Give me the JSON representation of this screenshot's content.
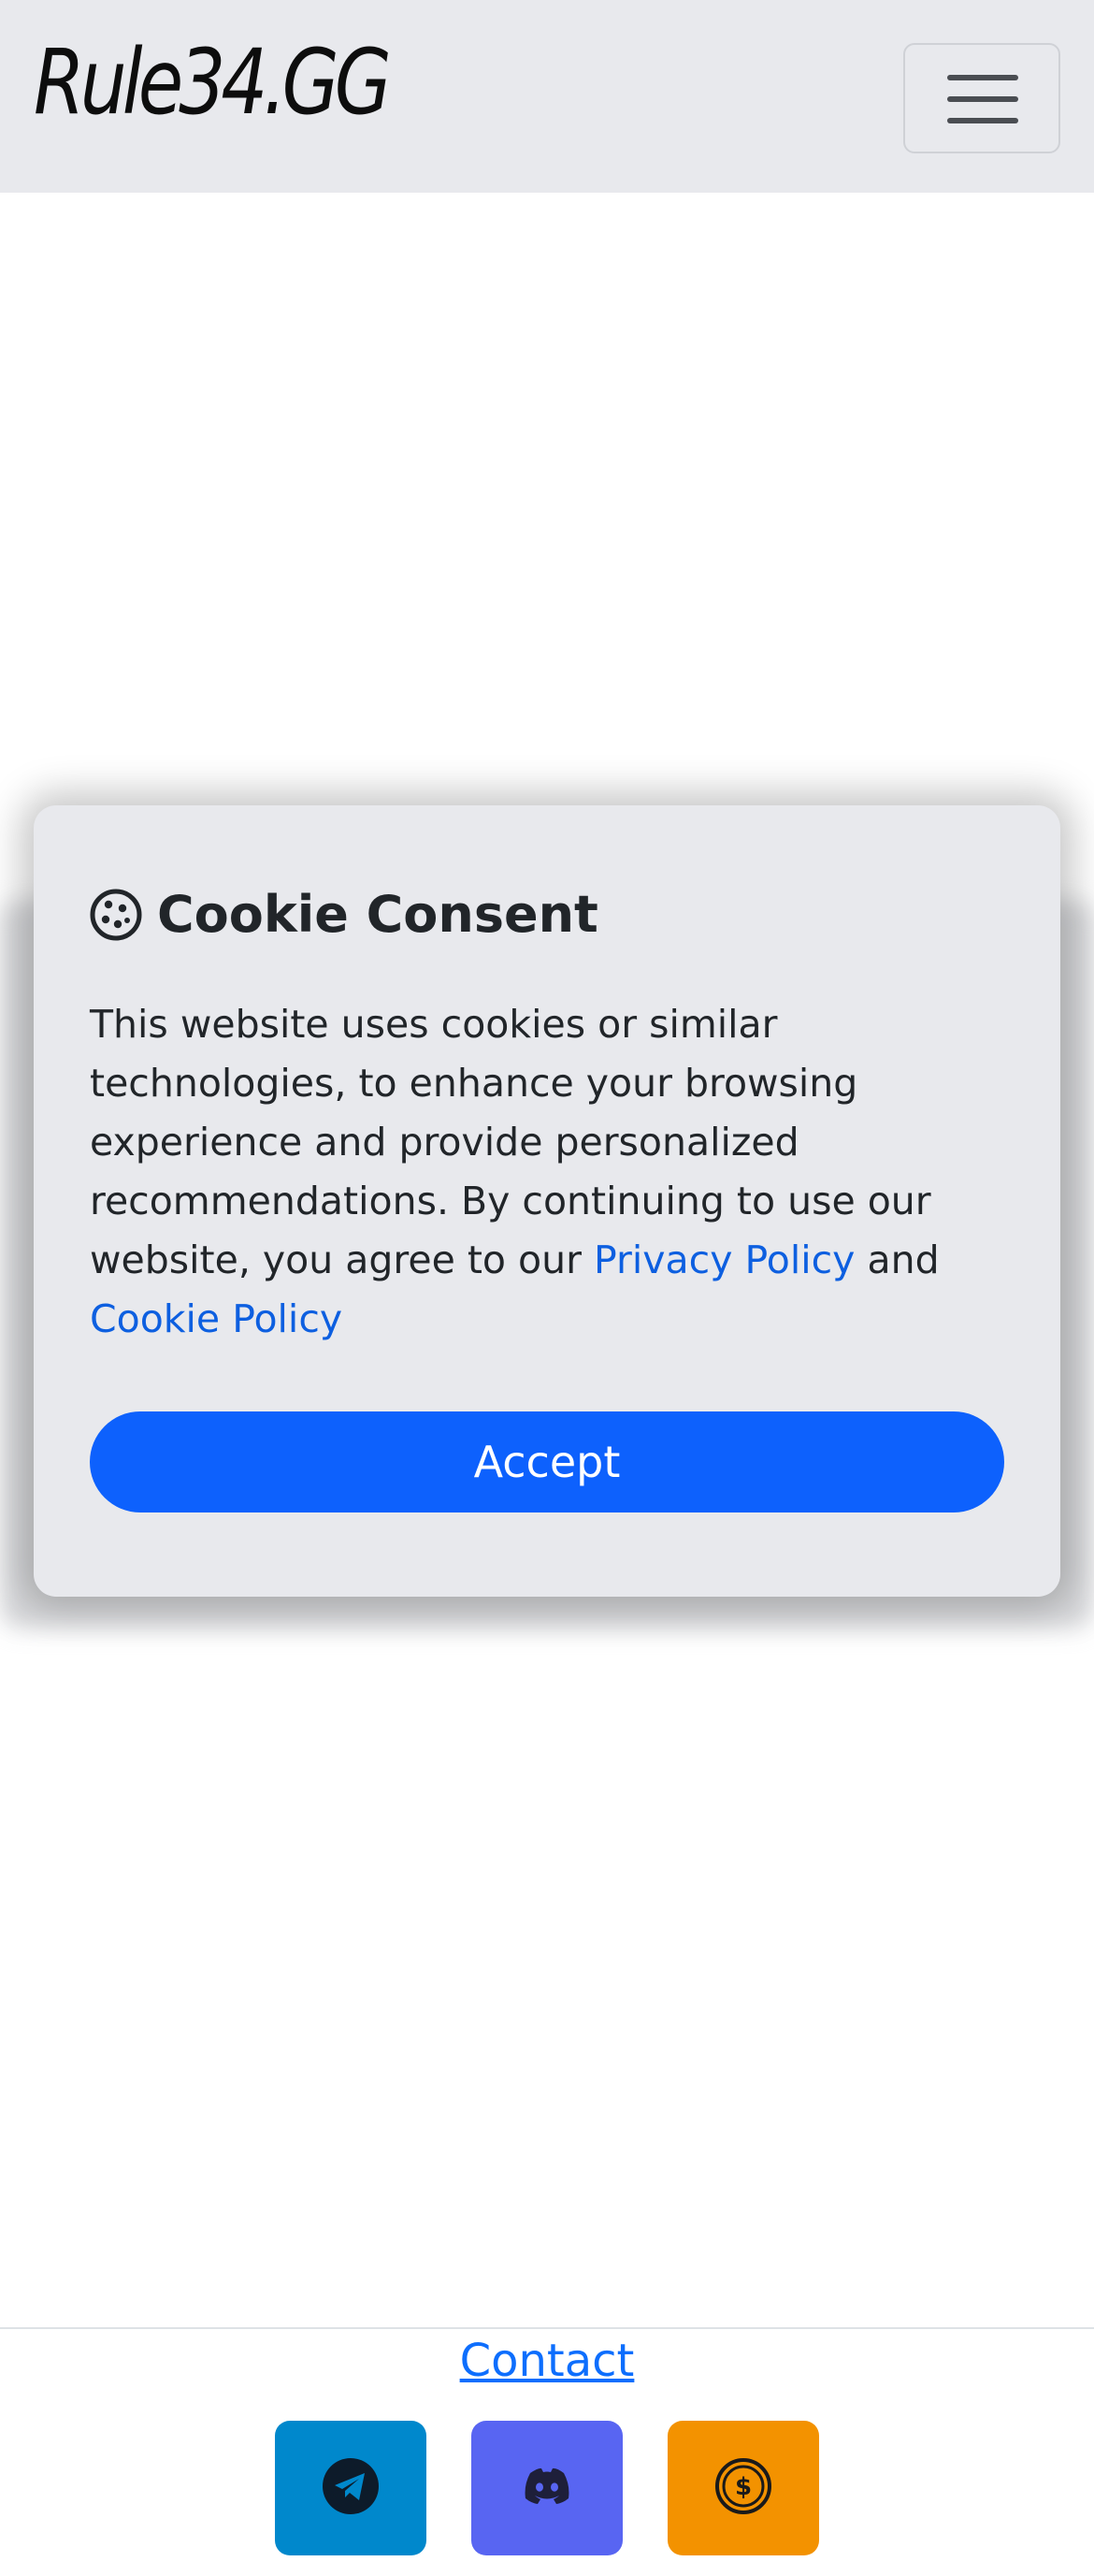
{
  "navbar": {
    "brand": "Rule34.GG",
    "menu_icon": "hamburger-menu-icon"
  },
  "cookie": {
    "icon": "cookie-icon",
    "title": "Cookie Consent",
    "body_text": "This website uses cookies or similar technologies, to enhance your browsing experience and provide personalized recommendations. By continuing to use our website, you agree to our",
    "privacy_link": "Privacy Policy",
    "conjunction": "and",
    "cookie_link": "Cookie Policy",
    "accept_label": "Accept",
    "colors": {
      "accent": "#0d61fd",
      "panel": "#e8e9ed"
    }
  },
  "footer": {
    "contact_label": "Contact",
    "social": [
      {
        "icon": "telegram-icon",
        "color": "#0088cc"
      },
      {
        "icon": "discord-icon",
        "color": "#5865f2"
      },
      {
        "icon": "dollar-coin-icon",
        "color": "#f39200"
      }
    ]
  }
}
